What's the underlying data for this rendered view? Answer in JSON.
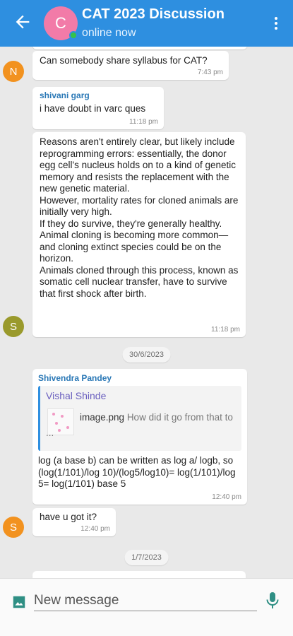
{
  "header": {
    "avatar_letter": "C",
    "title": "CAT 2023 Discussion",
    "status": "online now"
  },
  "messages": [
    {
      "avatar_letter": "N",
      "avatar_color": "#f2921f",
      "text": "Can somebody share syllabus for CAT?",
      "time": "7:43 pm"
    },
    {
      "sender": "shivani garg",
      "text": "i have doubt in varc ques",
      "time": "11:18 pm"
    },
    {
      "avatar_letter": "S",
      "avatar_color": "#9a9a2c",
      "text": "Reasons aren't entirely clear, but likely include reprogramming errors: essentially, the donor egg cell's nucleus holds on to a kind of genetic memory and resists the replacement with the new genetic material.\nHowever, mortality rates for cloned animals are initially very high.\nIf they do survive, they're generally healthy. Animal cloning is becoming more common—and cloning extinct species could be on the horizon.\nAnimals cloned through this process, known as somatic cell nuclear transfer, have to survive that first shock after birth.",
      "time": "11:18 pm"
    },
    {
      "sender": "Shivendra Pandey",
      "reply": {
        "name": "Vishal Shinde",
        "file": "image.png",
        "preview": "How did it go from that to ..."
      },
      "text": "log (a base b) can be written as log a/ logb, so (log(1/101)/log 10)/(log5/log10)= log(1/101)/log 5= log(1/101) base 5",
      "time": "12:40 pm"
    },
    {
      "avatar_letter": "S",
      "avatar_color": "#f2921f",
      "text": "have u got it?",
      "time": "12:40 pm"
    }
  ],
  "dates": [
    "30/6/2023",
    "1/7/2023"
  ],
  "composer": {
    "placeholder": "New message"
  }
}
